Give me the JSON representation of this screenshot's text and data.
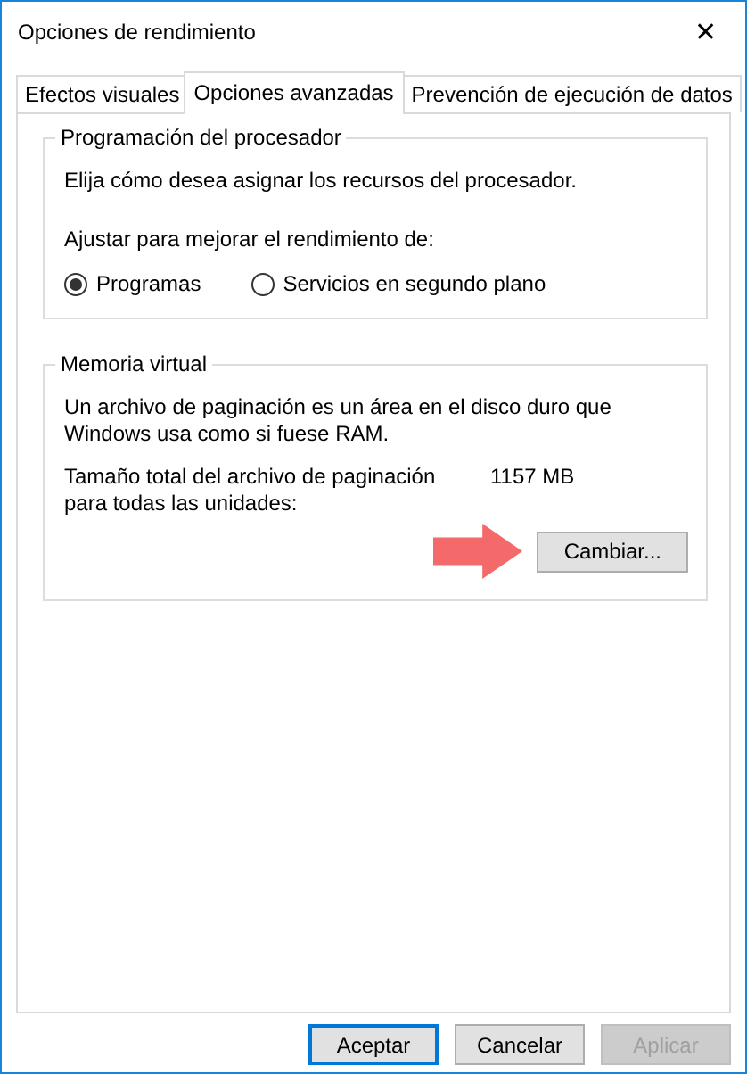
{
  "window": {
    "title": "Opciones de rendimiento",
    "close": "✕"
  },
  "tabs": [
    {
      "label": "Efectos visuales",
      "selected": false
    },
    {
      "label": "Opciones avanzadas",
      "selected": true
    },
    {
      "label": "Prevención de ejecución de datos",
      "selected": false
    }
  ],
  "processor": {
    "title": "Programación del procesador",
    "description": "Elija cómo desea asignar los recursos del procesador.",
    "prompt": "Ajustar para mejorar el rendimiento de:",
    "options": [
      {
        "label": "Programas",
        "selected": true
      },
      {
        "label": "Servicios en segundo plano",
        "selected": false
      }
    ]
  },
  "virtual_memory": {
    "title": "Memoria virtual",
    "description": "Un archivo de paginación es un área en el disco duro que Windows usa como si fuese RAM.",
    "total_label": "Tamaño total del archivo de paginación para todas las unidades:",
    "total_value": "1157 MB",
    "button": "Cambiar..."
  },
  "buttons": [
    {
      "label": "Aceptar",
      "default": true,
      "disabled": false
    },
    {
      "label": "Cancelar",
      "default": false,
      "disabled": false
    },
    {
      "label": "Aplicar",
      "default": false,
      "disabled": true
    }
  ]
}
